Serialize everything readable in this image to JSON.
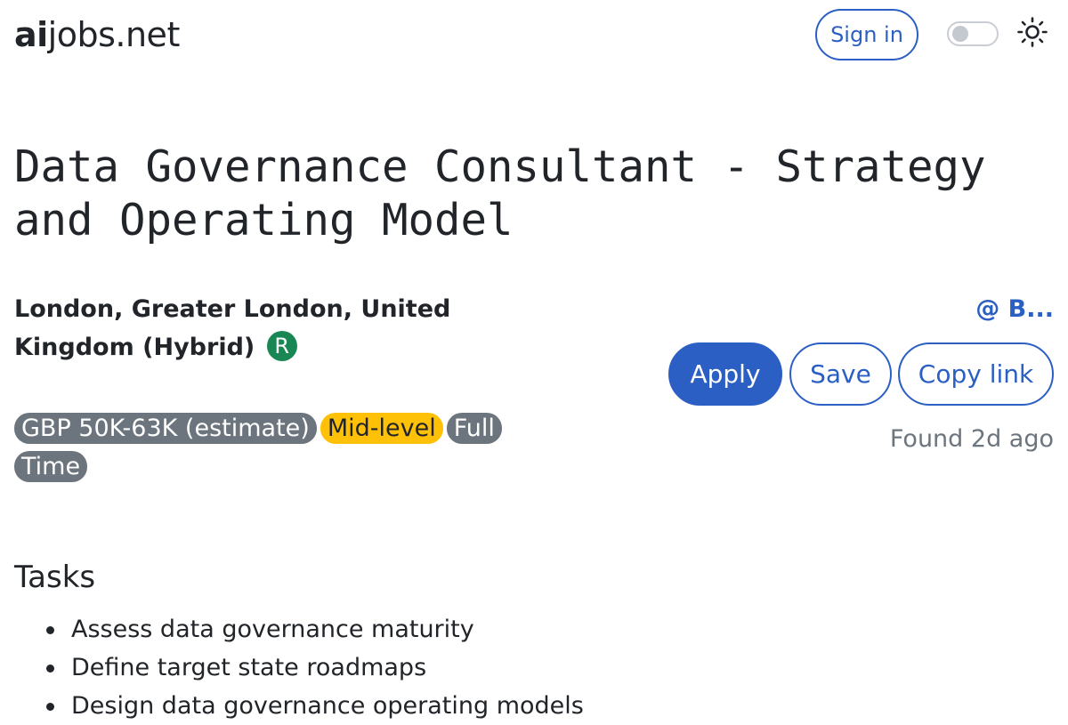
{
  "header": {
    "logo_bold": "ai",
    "logo_rest": "jobs.net",
    "signin_label": "Sign in",
    "theme_icon": "sun-icon"
  },
  "job": {
    "title": "Data Governance Consultant - Strategy and Operating Model",
    "location": "London, Greater London, United Kingdom (Hybrid)",
    "remote_badge": "R",
    "company": "@ B...",
    "tags": [
      "GBP 50K-63K (estimate)",
      "Mid-level",
      "Full Time"
    ],
    "found": "Found 2d ago"
  },
  "actions": {
    "apply_label": "Apply",
    "save_label": "Save",
    "copy_label": "Copy link"
  },
  "tasks": {
    "heading": "Tasks",
    "items": [
      "Assess data governance maturity",
      "Define target state roadmaps",
      "Design data governance operating models"
    ]
  },
  "colors": {
    "primary": "#2c5fc3",
    "badge_gray": "#6c757d",
    "badge_warning": "#ffc107",
    "badge_success": "#198754"
  }
}
